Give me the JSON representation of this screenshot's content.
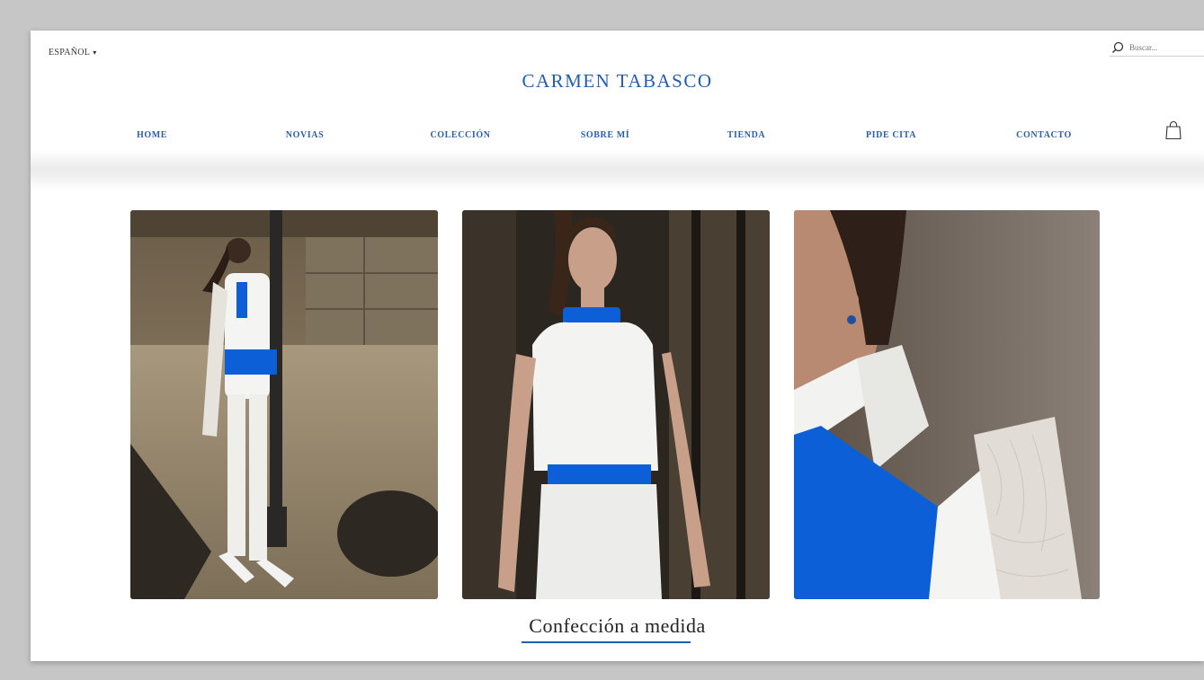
{
  "header": {
    "language": "ESPAÑOL",
    "search_placeholder": "Buscar...",
    "logo": "CARMEN TABASCO"
  },
  "nav": {
    "items": [
      {
        "label": "HOME"
      },
      {
        "label": "NOVIAS"
      },
      {
        "label": "COLECCIÓN"
      },
      {
        "label": "SOBRE MÍ"
      },
      {
        "label": "TIENDA"
      },
      {
        "label": "PIDE CITA"
      },
      {
        "label": "CONTACTO"
      }
    ]
  },
  "gallery": {
    "caption": "Confección a medida"
  },
  "colors": {
    "brand_blue": "#1f5fb0",
    "accent_blue": "#0d5fd8",
    "background": "#ffffff"
  },
  "icons": [
    "chevron-down-icon",
    "search-icon",
    "shopping-bag-icon"
  ]
}
